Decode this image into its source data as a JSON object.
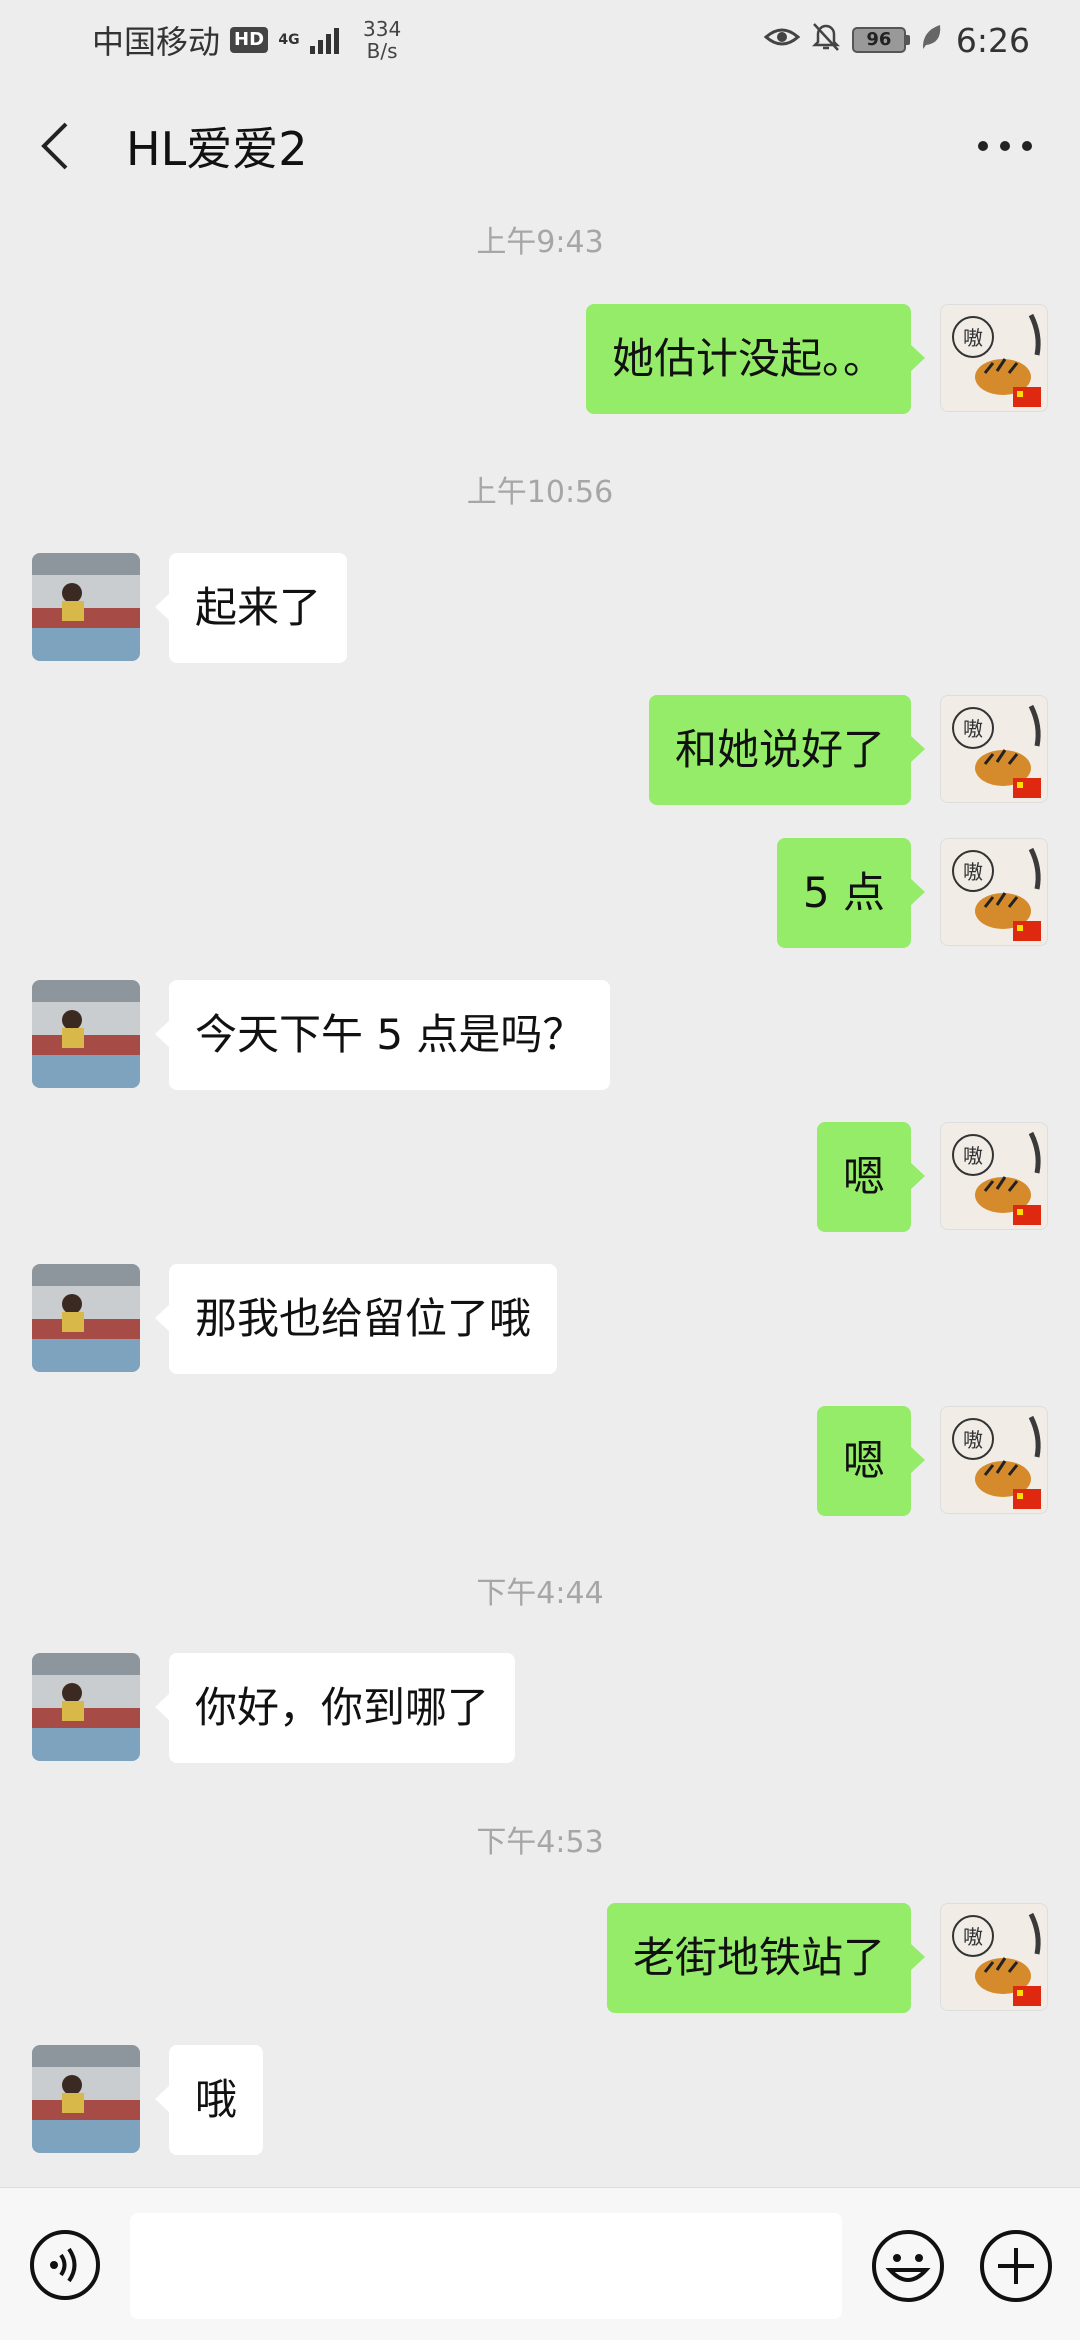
{
  "status_bar": {
    "carrier": "中国移动",
    "hd": "HD",
    "network": "4G",
    "speed_value": "334",
    "speed_unit": "B/s",
    "battery": "96",
    "time": "6:26"
  },
  "header": {
    "title": "HL爱爱2"
  },
  "messages": [
    {
      "type": "time",
      "text": "上午9:43"
    },
    {
      "type": "msg",
      "side": "self",
      "text": "她估计没起。。"
    },
    {
      "type": "time",
      "text": "上午10:56"
    },
    {
      "type": "msg",
      "side": "other",
      "text": "起来了"
    },
    {
      "type": "msg",
      "side": "self",
      "text": "和她说好了"
    },
    {
      "type": "msg",
      "side": "self",
      "text": "5 点"
    },
    {
      "type": "msg",
      "side": "other",
      "text": "今天下午 5 点是吗？"
    },
    {
      "type": "msg",
      "side": "self",
      "text": "嗯"
    },
    {
      "type": "msg",
      "side": "other",
      "text": "那我也给留位了哦"
    },
    {
      "type": "msg",
      "side": "self",
      "text": "嗯"
    },
    {
      "type": "time",
      "text": "下午4:44"
    },
    {
      "type": "msg",
      "side": "other",
      "text": "你好，你到哪了"
    },
    {
      "type": "time",
      "text": "下午4:53"
    },
    {
      "type": "msg",
      "side": "self",
      "text": "老街地铁站了"
    },
    {
      "type": "msg",
      "side": "other",
      "text": "哦"
    }
  ],
  "input": {
    "value": ""
  },
  "colors": {
    "self_bubble": "#95ec69",
    "other_bubble": "#ffffff",
    "background": "#ededed"
  },
  "icons": {
    "back": "back-arrow-icon",
    "more": "more-dots-icon",
    "voice": "voice-icon",
    "emoji": "emoji-icon",
    "plus": "plus-icon"
  }
}
